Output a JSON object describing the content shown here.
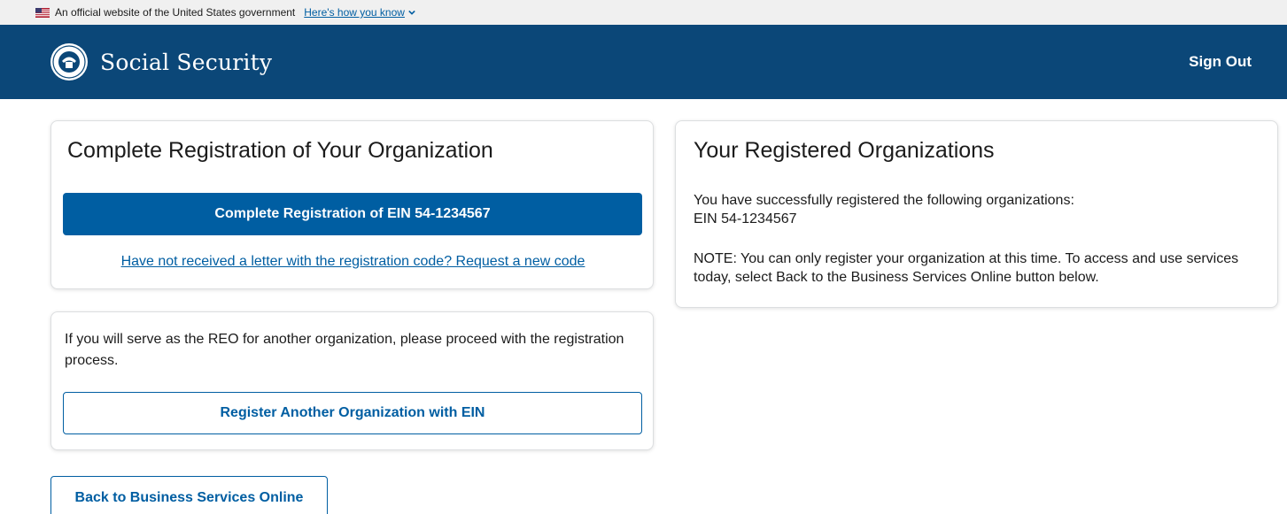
{
  "gov_banner": {
    "text": "An official website of the United States government",
    "link_label": "Here's how you know",
    "flag_icon": "us-flag-icon"
  },
  "header": {
    "brand": "Social Security",
    "sign_out": "Sign Out",
    "background_color": "#0b4778"
  },
  "registration_card": {
    "title": "Complete Registration of Your Organization",
    "complete_button": "Complete Registration of EIN 54-1234567",
    "request_link": "Have not received a letter with the registration code? Request a new code"
  },
  "reo_card": {
    "text": "If you will serve as the REO for another organization, please proceed with the registration process.",
    "register_button": "Register Another Organization with EIN"
  },
  "registered_card": {
    "title": "Your Registered Organizations",
    "intro": "You have successfully registered the following organizations:",
    "ein": "EIN 54-1234567",
    "note": "NOTE: You can only register your organization at this time. To access and use services today, select Back to the Business Services Online button below."
  },
  "back_button": "Back to Business Services Online",
  "colors": {
    "primary": "#005ea2",
    "header": "#0b4778",
    "banner": "#f0f0f0"
  }
}
